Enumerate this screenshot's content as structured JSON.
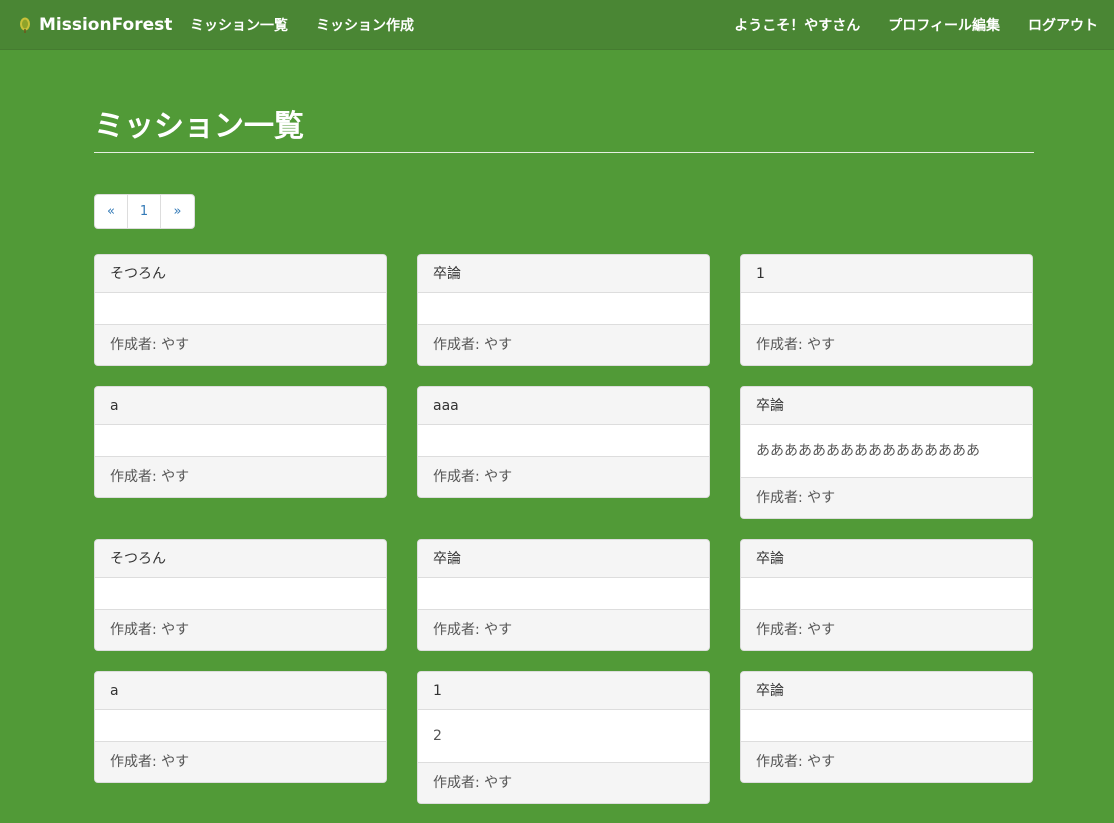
{
  "navbar": {
    "brand": "MissionForest",
    "left_links": [
      "ミッション一覧",
      "ミッション作成"
    ],
    "right_links": [
      "ようこそ！やすさん",
      "プロフィール編集",
      "ログアウト"
    ]
  },
  "page_title": "ミッション一覧",
  "pagination": [
    "«",
    "1",
    "»"
  ],
  "colors": {
    "page_background": "#519a37",
    "navbar_background": "#4a8634",
    "link": "#337ab7"
  },
  "missions": [
    {
      "title": "そつろん",
      "description": "",
      "author": "作成者: やす"
    },
    {
      "title": "卒論",
      "description": "",
      "author": "作成者: やす"
    },
    {
      "title": "1",
      "description": "",
      "author": "作成者: やす"
    },
    {
      "title": "a",
      "description": "",
      "author": "作成者: やす"
    },
    {
      "title": "aaa",
      "description": "",
      "author": "作成者: やす"
    },
    {
      "title": "卒論",
      "description": "ああああああああああああああああ",
      "author": "作成者: やす"
    },
    {
      "title": "そつろん",
      "description": "",
      "author": "作成者: やす"
    },
    {
      "title": "卒論",
      "description": "",
      "author": "作成者: やす"
    },
    {
      "title": "卒論",
      "description": "",
      "author": "作成者: やす"
    },
    {
      "title": "a",
      "description": "",
      "author": "作成者: やす"
    },
    {
      "title": "1",
      "description": "2",
      "author": "作成者: やす"
    },
    {
      "title": "卒論",
      "description": "",
      "author": "作成者: やす"
    }
  ]
}
